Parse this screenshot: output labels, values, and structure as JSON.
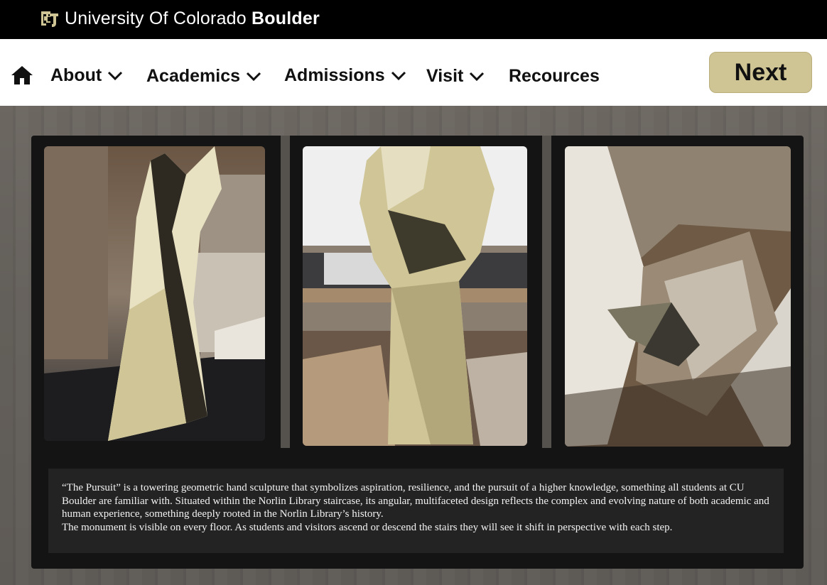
{
  "header": {
    "logo_icon": "cu-buffalo-logo-icon",
    "brand_light": "University Of Colorado ",
    "brand_bold": "Boulder"
  },
  "nav": {
    "home_icon": "home-icon",
    "items": [
      {
        "label": "About",
        "has_dropdown": true
      },
      {
        "label": "Academics",
        "has_dropdown": true
      },
      {
        "label": "Admissions",
        "has_dropdown": true
      },
      {
        "label": "Visit",
        "has_dropdown": true
      },
      {
        "label": "Recources",
        "has_dropdown": false
      }
    ],
    "next_label": "Next"
  },
  "gallery": {
    "photos": [
      {
        "name": "sculpture-hand-lobby-photo"
      },
      {
        "name": "sculpture-fist-atrium-photo"
      },
      {
        "name": "sculpture-hand-staircase-photo"
      }
    ]
  },
  "caption": {
    "paragraph1": "“The Pursuit” is a towering geometric hand sculpture that symbolizes aspiration, resilience, and the pursuit of a higher knowledge, something all students at CU Boulder are familiar with. Situated within the Norlin Library staircase, its angular, multifaceted design reflects the complex and evolving nature of both academic and human experience, something deeply rooted in the Norlin Library’s history.",
    "paragraph2": "The monument is visible on every floor. As students and visitors ascend or descend the stairs they will see it shift in perspective with each step."
  },
  "colors": {
    "brand_gold": "#cfc493",
    "topbar": "#000000",
    "panel": "#141414",
    "caption_box": "#232323"
  }
}
